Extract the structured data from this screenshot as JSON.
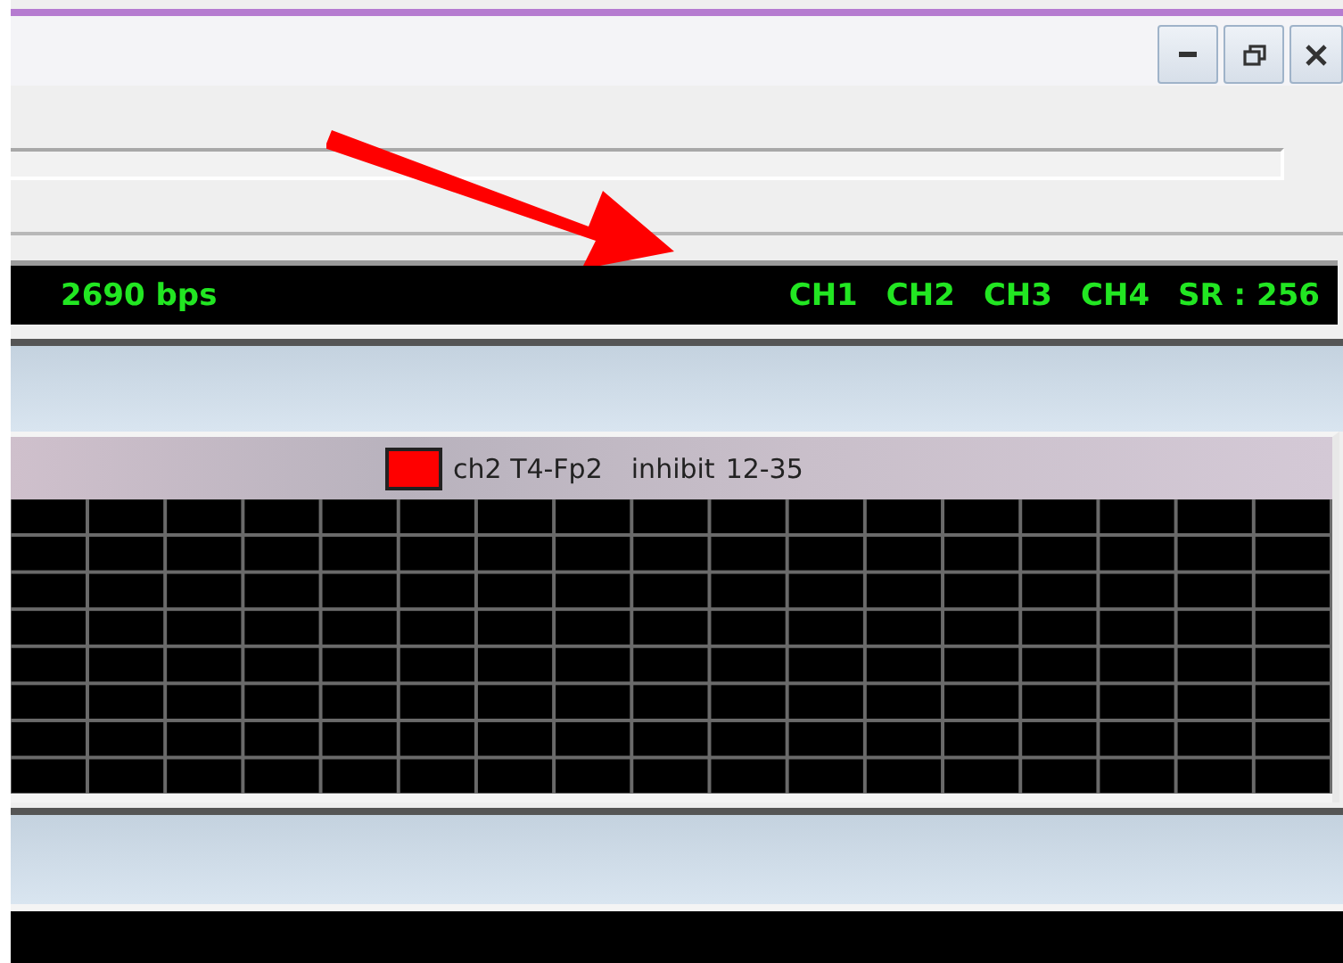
{
  "status_bar": {
    "rate": "2690 bps",
    "channels": [
      "CH1",
      "CH2",
      "CH3",
      "CH4"
    ],
    "sample_rate": "SR : 256"
  },
  "channel_panel": {
    "color": "#ff0000",
    "label": "ch2 T4-Fp2",
    "mode": "inhibit",
    "range": "12-35"
  }
}
